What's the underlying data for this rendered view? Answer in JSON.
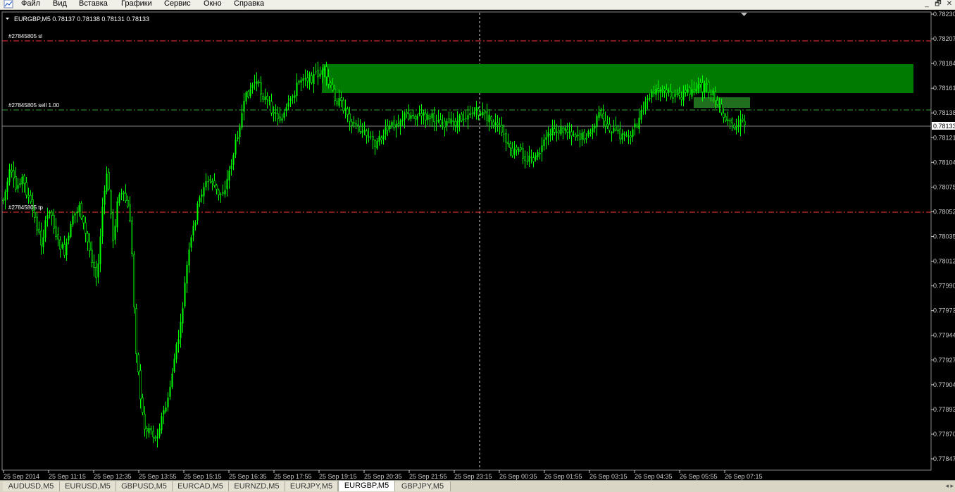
{
  "menu": [
    "Файл",
    "Вид",
    "Вставка",
    "Графики",
    "Сервис",
    "Окно",
    "Справка"
  ],
  "window_controls": {
    "minimize": "_",
    "restore": "🗗",
    "close": "✕"
  },
  "chart": {
    "header": "EURGBP,M5  0.78137 0.78138 0.78131 0.78133",
    "price_labels": [
      "0.78230",
      "0.78207",
      "0.78184",
      "0.78161",
      "0.78138",
      "0.78121",
      "0.78104",
      "0.78075",
      "0.78052",
      "0.78035",
      "0.78012",
      "0.77990",
      "0.77973",
      "0.77944",
      "0.77927",
      "0.77904",
      "0.77893",
      "0.77870",
      "0.77847"
    ],
    "current_price": "0.78133",
    "time_labels": [
      "25 Sep 2014",
      "25 Sep 11:15",
      "25 Sep 12:35",
      "25 Sep 13:55",
      "25 Sep 15:15",
      "25 Sep 16:35",
      "25 Sep 17:55",
      "25 Sep 19:15",
      "25 Sep 20:35",
      "25 Sep 21:55",
      "25 Sep 23:15",
      "26 Sep 00:35",
      "26 Sep 01:55",
      "26 Sep 03:15",
      "26 Sep 04:35",
      "26 Sep 05:55",
      "26 Sep 07:15"
    ],
    "order_lines": [
      {
        "label": "#27845805 sl",
        "kind": "sl",
        "color": "#ff3030"
      },
      {
        "label": "#27845805 sell 1.00",
        "kind": "entry",
        "color": "#2fa22f"
      },
      {
        "label": "#27845805 tp",
        "kind": "tp",
        "color": "#ff3030"
      }
    ],
    "colors": {
      "background": "#000000",
      "candles": "#00ff00",
      "zone": "#007a00",
      "axis": "#c0c0c0"
    }
  },
  "tabs": [
    "AUDUSD,M5",
    "EURUSD,M5",
    "GBPUSD,M5",
    "EURCAD,M5",
    "EURNZD,M5",
    "EURJPY,M5",
    "EURGBP,M5",
    "GBPJPY,M5"
  ],
  "active_tab": "EURGBP,M5"
}
